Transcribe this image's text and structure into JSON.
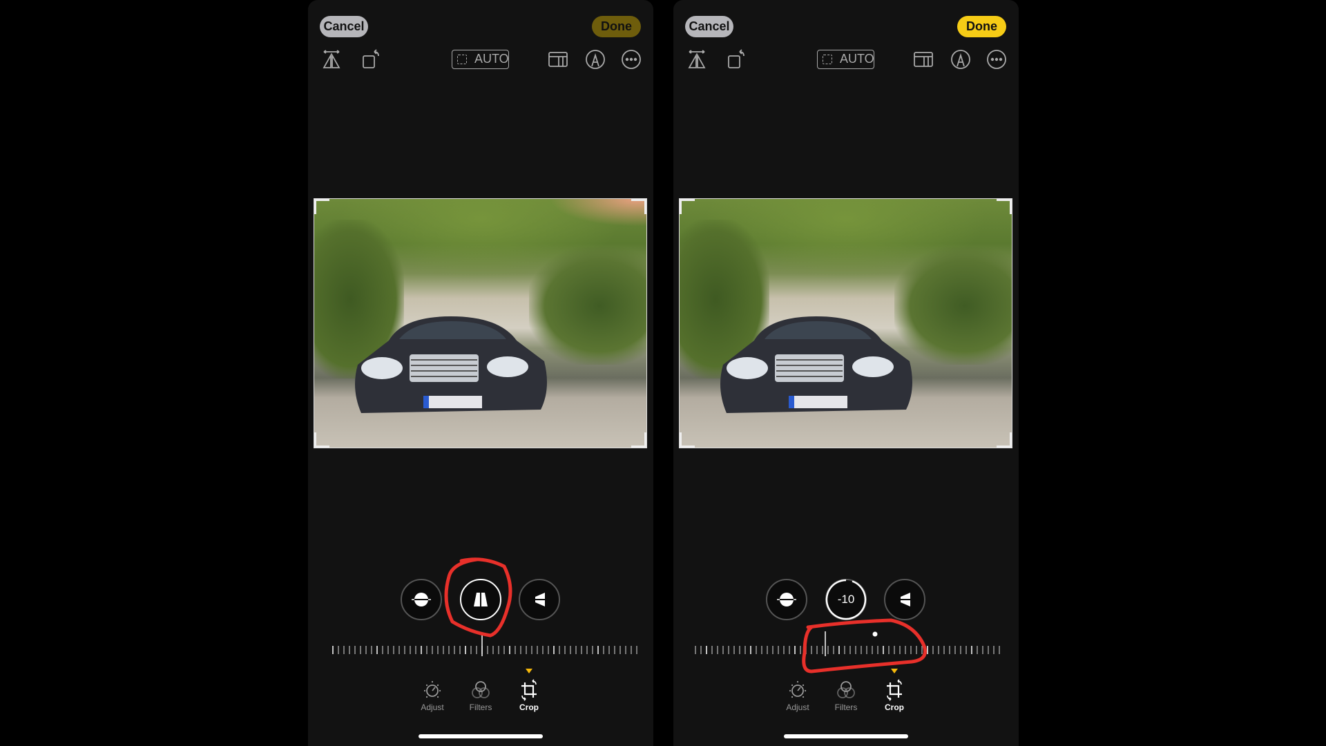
{
  "panels": [
    {
      "cancel_label": "Cancel",
      "done_label": "Done",
      "auto_label": "AUTO",
      "active_dial": "vertical",
      "dial_value": "",
      "tabs": [
        {
          "label": "Adjust",
          "icon": "adjust-icon"
        },
        {
          "label": "Filters",
          "icon": "filters-icon"
        },
        {
          "label": "Crop",
          "icon": "crop-icon"
        }
      ],
      "active_tab": "Crop",
      "done_color": "#6e5d0c"
    },
    {
      "cancel_label": "Cancel",
      "done_label": "Done",
      "auto_label": "AUTO",
      "active_dial": "vertical",
      "dial_value": "-10",
      "tabs": [
        {
          "label": "Adjust",
          "icon": "adjust-icon"
        },
        {
          "label": "Filters",
          "icon": "filters-icon"
        },
        {
          "label": "Crop",
          "icon": "crop-icon"
        }
      ],
      "active_tab": "Crop",
      "done_color": "#f6cc16"
    }
  ],
  "toolbar_icons": [
    "flip-horizontal-icon",
    "rotate-icon",
    "auto-straighten-icon",
    "aspect-ratio-icon",
    "markup-icon",
    "more-icon"
  ],
  "dial_icons": [
    "straighten-icon",
    "vertical-perspective-icon",
    "horizontal-perspective-icon"
  ],
  "annotation_color": "#e8302a"
}
